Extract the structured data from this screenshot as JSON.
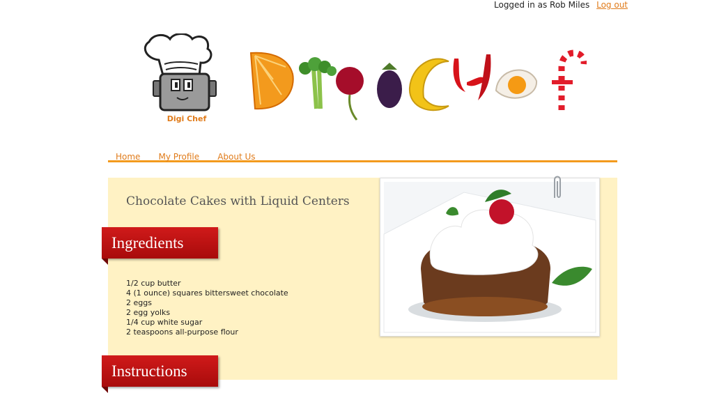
{
  "header": {
    "login_text": "Logged in as Rob Miles",
    "logout_label": "Log out",
    "logo_caption": "Digi Chef"
  },
  "nav": [
    "Home",
    "My Profile",
    "About Us"
  ],
  "recipe": {
    "title": "Chocolate Cakes with Liquid Centers",
    "ingredients_heading": "Ingredients",
    "instructions_heading": "Instructions",
    "ingredients": [
      "1/2 cup butter",
      "4 (1 ounce) squares bittersweet chocolate",
      "2 eggs",
      "2 egg yolks",
      "1/4 cup white sugar",
      "2 teaspoons all-purpose flour"
    ]
  },
  "colors": {
    "accent": "#e07b1a",
    "nav_rule": "#f39a1d",
    "content_bg": "#fff2c4",
    "ribbon": "#c4131a"
  }
}
